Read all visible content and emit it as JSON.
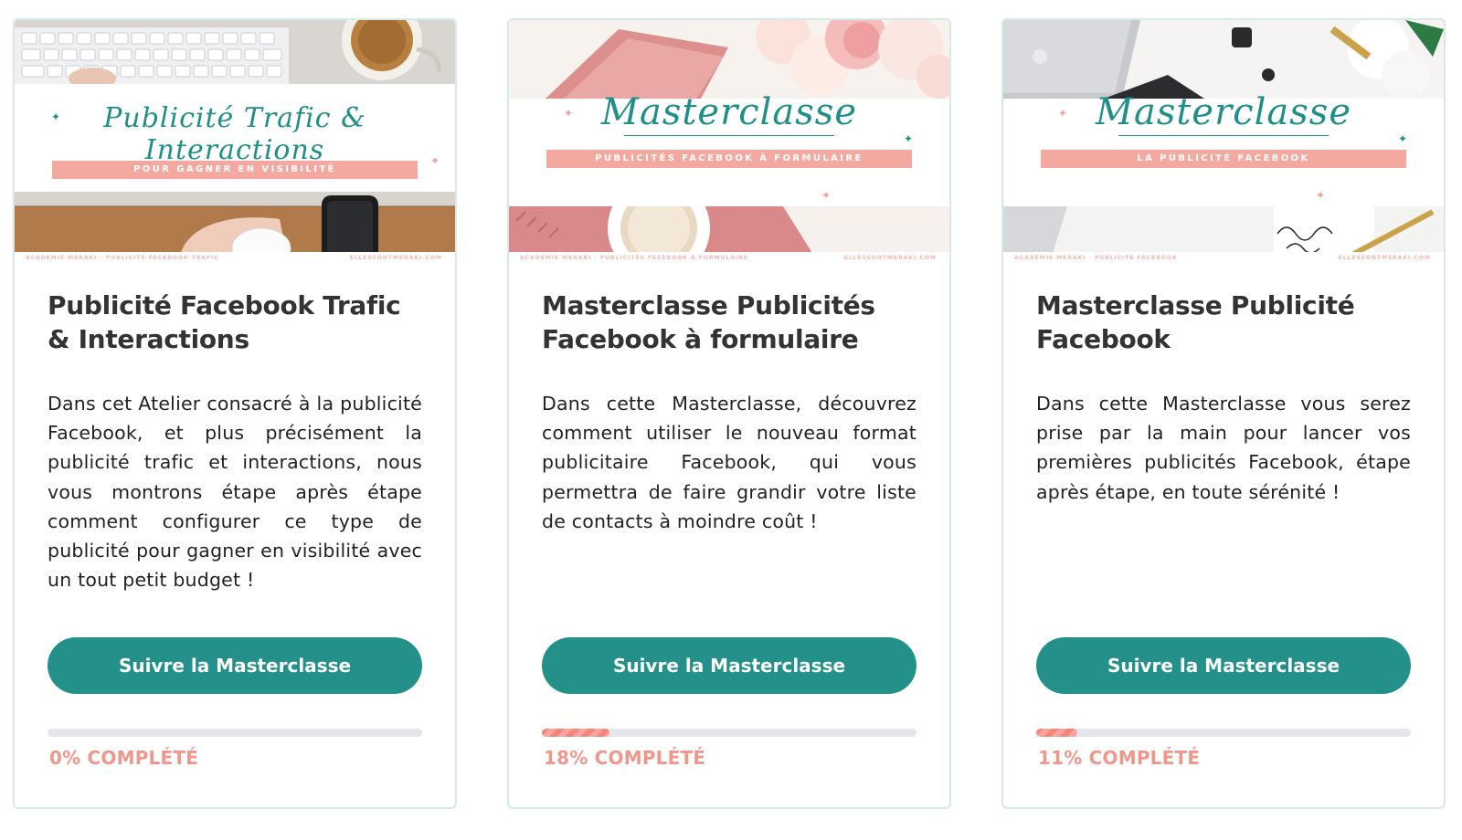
{
  "colors": {
    "accent": "#23918a",
    "progress_label": "#f0978c",
    "progress_fill": "#f3857a",
    "progress_track": "#e3e6ea",
    "ribbon": "#f4a9a0",
    "border": "#d9e8ea"
  },
  "cards": [
    {
      "thumbnail": {
        "script_title": "Publicité Trafic & Interactions",
        "ribbon": "POUR GAGNER EN VISIBILITÉ",
        "footer_left": "ACADÉMIE MERAKI · PUBLICITÉ FACEBOOK TRAFIC",
        "footer_right": "ELLESSONTMERAKI.COM"
      },
      "title": "Publicité Facebook Trafic & Interactions",
      "description": "Dans cet Atelier consacré à la publicité Facebook, et plus précisément la publicité trafic et interactions, nous vous montrons étape après étape comment configurer ce type de publicité pour gagner en visibilité avec un tout petit budget !",
      "button_label": "Suivre la Masterclasse",
      "progress_percent": 0,
      "progress_label": "0% COMPLÉTÉ"
    },
    {
      "thumbnail": {
        "script_title": "Masterclasse",
        "ribbon": "PUBLICITÉS FACEBOOK À FORMULAIRE",
        "footer_left": "ACADÉMIE MERAKI · PUBLICITÉS FACEBOOK À FORMULAIRE",
        "footer_right": "ELLESSONTMERAKI.COM"
      },
      "title": "Masterclasse Publicités Facebook à formulaire",
      "description": "Dans cette Masterclasse, découvrez comment utiliser le nouveau format publicitaire Facebook, qui vous permettra de faire grandir votre liste de contacts à moindre coût !",
      "button_label": "Suivre la Masterclasse",
      "progress_percent": 18,
      "progress_label": "18% COMPLÉTÉ"
    },
    {
      "thumbnail": {
        "script_title": "Masterclasse",
        "ribbon": "LA PUBLICITÉ FACEBOOK",
        "footer_left": "ACADÉMIE MERAKI · PUBLICITÉ FACEBOOK",
        "footer_right": "ELLESSONTMERAKI.COM"
      },
      "title": "Masterclasse Publicité Facebook",
      "description": "Dans cette Masterclasse vous serez prise par la main pour lancer vos premières publicités Facebook, étape après étape, en toute sérénité !",
      "button_label": "Suivre la Masterclasse",
      "progress_percent": 11,
      "progress_label": "11% COMPLÉTÉ"
    }
  ]
}
